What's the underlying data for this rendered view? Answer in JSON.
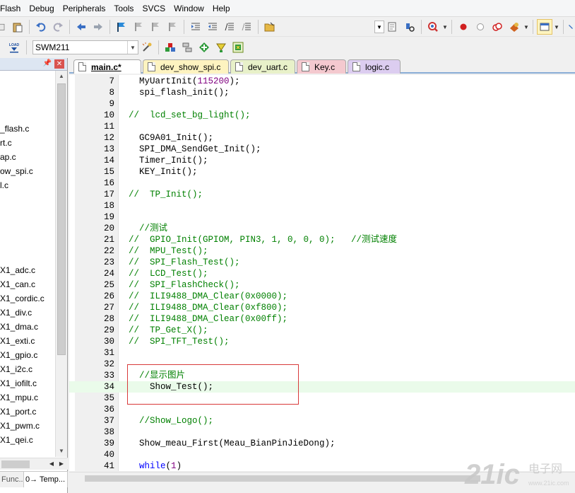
{
  "menu": [
    "Flash",
    "Debug",
    "Peripherals",
    "Tools",
    "SVCS",
    "Window",
    "Help"
  ],
  "toolbar2": {
    "target": "SWM211",
    "load_label": "LOAD"
  },
  "editor_tabs": [
    {
      "label": "main.c*",
      "color": "#ffffff",
      "active": true
    },
    {
      "label": "dev_show_spi.c",
      "color": "#fdf3c0",
      "active": false
    },
    {
      "label": "dev_uart.c",
      "color": "#e8f1c9",
      "active": false
    },
    {
      "label": "Key.c",
      "color": "#f4c9cf",
      "active": false
    },
    {
      "label": "logic.c",
      "color": "#dccdf0",
      "active": false
    }
  ],
  "files": [
    {
      "name": "_flash.c",
      "row": 4
    },
    {
      "name": "rt.c",
      "row": 5
    },
    {
      "name": "ap.c",
      "row": 6
    },
    {
      "name": "ow_spi.c",
      "row": 7
    },
    {
      "name": "l.c",
      "row": 8
    },
    {
      "name": "X1_adc.c",
      "row": 14
    },
    {
      "name": "X1_can.c",
      "row": 15
    },
    {
      "name": "X1_cordic.c",
      "row": 16
    },
    {
      "name": "X1_div.c",
      "row": 17
    },
    {
      "name": "X1_dma.c",
      "row": 18
    },
    {
      "name": "X1_exti.c",
      "row": 19
    },
    {
      "name": "X1_gpio.c",
      "row": 20
    },
    {
      "name": "X1_i2c.c",
      "row": 21
    },
    {
      "name": "X1_iofilt.c",
      "row": 22
    },
    {
      "name": "X1_mpu.c",
      "row": 23
    },
    {
      "name": "X1_port.c",
      "row": 24
    },
    {
      "name": "X1_pwm.c",
      "row": 25
    },
    {
      "name": "X1_qei.c",
      "row": 26
    }
  ],
  "left_tabs": [
    "Func...",
    "0→ Temp..."
  ],
  "code_lines": [
    {
      "n": "7",
      "t": "  MyUartInit(115200);"
    },
    {
      "n": "8",
      "t": "  spi_flash_init();"
    },
    {
      "n": "9",
      "t": ""
    },
    {
      "n": "10",
      "t": "//  lcd_set_bg_light();"
    },
    {
      "n": "11",
      "t": ""
    },
    {
      "n": "12",
      "t": "  GC9A01_Init();"
    },
    {
      "n": "13",
      "t": "  SPI_DMA_SendGet_Init();"
    },
    {
      "n": "14",
      "t": "  Timer_Init();"
    },
    {
      "n": "15",
      "t": "  KEY_Init();"
    },
    {
      "n": "16",
      "t": ""
    },
    {
      "n": "17",
      "t": "//  TP_Init();"
    },
    {
      "n": "18",
      "t": ""
    },
    {
      "n": "19",
      "t": ""
    },
    {
      "n": "20",
      "t": "  //测试"
    },
    {
      "n": "21",
      "t": "//  GPIO_Init(GPIOM, PIN3, 1, 0, 0, 0);   //测试速度"
    },
    {
      "n": "22",
      "t": "//  MPU_Test();"
    },
    {
      "n": "23",
      "t": "//  SPI_Flash_Test();"
    },
    {
      "n": "24",
      "t": "//  LCD_Test();"
    },
    {
      "n": "25",
      "t": "//  SPI_FlashCheck();"
    },
    {
      "n": "26",
      "t": "//  ILI9488_DMA_Clear(0x0000);"
    },
    {
      "n": "27",
      "t": "//  ILI9488_DMA_Clear(0xf800);"
    },
    {
      "n": "28",
      "t": "//  ILI9488_DMA_Clear(0x00ff);"
    },
    {
      "n": "29",
      "t": "//  TP_Get_X();"
    },
    {
      "n": "30",
      "t": "//  SPI_TFT_Test();"
    },
    {
      "n": "31",
      "t": ""
    },
    {
      "n": "32",
      "t": ""
    },
    {
      "n": "33",
      "t": "  //显示图片"
    },
    {
      "n": "34",
      "t": "    Show_Test();"
    },
    {
      "n": "35",
      "t": ""
    },
    {
      "n": "36",
      "t": ""
    },
    {
      "n": "37",
      "t": "  //Show_Logo();"
    },
    {
      "n": "38",
      "t": ""
    },
    {
      "n": "39",
      "t": "  Show_meau_First(Meau_BianPinJieDong);"
    },
    {
      "n": "40",
      "t": ""
    },
    {
      "n": "41",
      "t": "  while(1)"
    }
  ],
  "highlight_line": "34",
  "watermark": {
    "text": "21ic",
    "sub": "电子网"
  }
}
